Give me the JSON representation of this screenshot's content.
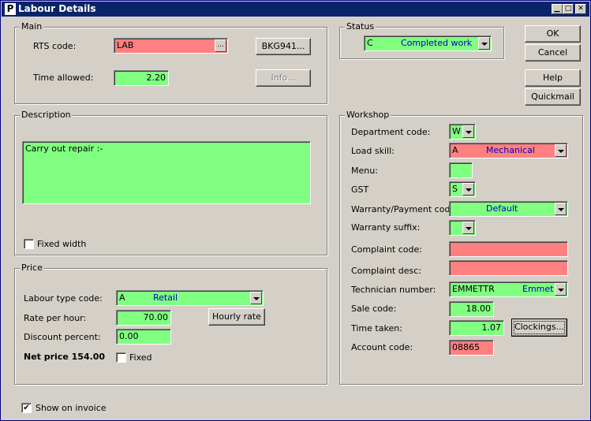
{
  "window": {
    "title": "Labour Details",
    "app_icon": "P"
  },
  "buttons": {
    "ok": "OK",
    "cancel": "Cancel",
    "help": "Help",
    "quickmail": "Quickmail"
  },
  "main": {
    "title": "Main",
    "rts_label": "RTS code:",
    "rts_value": "LAB",
    "rts_button": "...",
    "booking_button": "BKG941...",
    "time_label": "Time allowed:",
    "time_value": "2.20",
    "info_button": "Info..."
  },
  "status": {
    "title": "Status",
    "code": "C",
    "text": "Completed work"
  },
  "description": {
    "title": "Description",
    "text": "Carry out repair :-",
    "fixed_width_label": "Fixed width",
    "fixed_width_checked": false
  },
  "price": {
    "title": "Price",
    "labour_type_label": "Labour type code:",
    "labour_type_code": "A",
    "labour_type_text": "Retail",
    "rate_label": "Rate per hour:",
    "rate_value": "70.00",
    "hourly_rate_button": "Hourly rate",
    "discount_label": "Discount percent:",
    "discount_value": "0.00",
    "net_price": "Net price 154.00",
    "fixed_label": "Fixed",
    "fixed_checked": false
  },
  "workshop": {
    "title": "Workshop",
    "department_label": "Department code:",
    "department_value": "W",
    "load_skill_label": "Load skill:",
    "load_skill_code": "A",
    "load_skill_text": "Mechanical",
    "menu_label": "Menu:",
    "menu_value": "",
    "gst_label": "GST",
    "gst_value": "S",
    "warranty_label": "Warranty/Payment code",
    "warranty_value": "Default",
    "warranty_suffix_label": "Warranty suffix:",
    "warranty_suffix_value": "",
    "complaint_code_label": "Complaint code:",
    "complaint_code_value": "",
    "complaint_desc_label": "Complaint desc:",
    "complaint_desc_value": "",
    "technician_label": "Technician number:",
    "technician_code": "EMMETTR",
    "technician_name": "Emmett R",
    "sale_code_label": "Sale code:",
    "sale_code_value": "18.00",
    "time_taken_label": "Time taken:",
    "time_taken_value": "1.07",
    "clockings_button": "Clockings...",
    "account_label": "Account code:",
    "account_value": "08865"
  },
  "footer": {
    "show_invoice_label": "Show on invoice",
    "show_invoice_checked": true,
    "check_mark": "✔"
  },
  "colors": {
    "field_green": "#80ff80",
    "field_pink": "#ff8080",
    "title_bar": "#0a246a",
    "dialog_bg": "#d4d0c8",
    "dropdown_text_blue": "#0000c0"
  }
}
